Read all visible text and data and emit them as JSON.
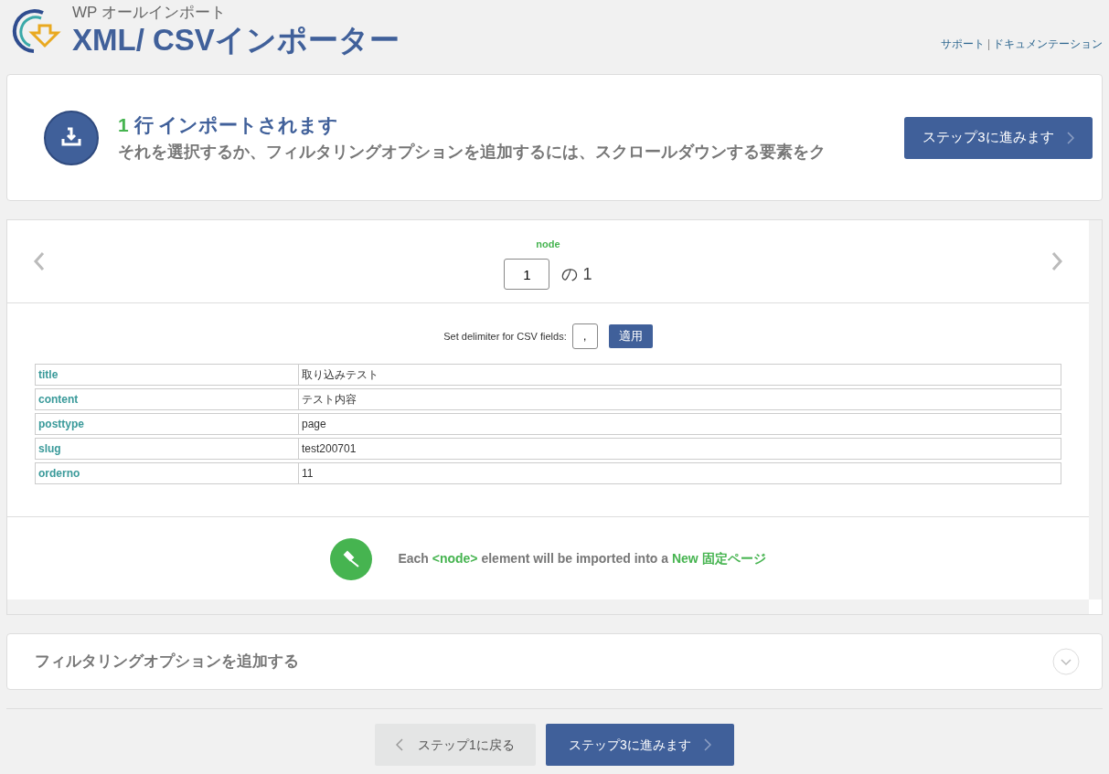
{
  "header": {
    "subtitle": "WP オールインポート",
    "title": "XML/ CSVインポーター",
    "links": [
      "サポート",
      "ドキュメンテーション"
    ],
    "link_separator": "|"
  },
  "summary": {
    "count": "1",
    "headline": "行 インポートされます",
    "description": "それを選択するか、フィルタリングオプションを追加するには、スクロールダウンする要素をク",
    "button": "ステップ3に進みます"
  },
  "preview": {
    "node_label": "node",
    "page_value": "1",
    "page_total": "の 1",
    "delimiter_label": "Set delimiter for CSV fields:",
    "delimiter_value": ",",
    "apply_button": "適用",
    "rows": [
      {
        "field": "title",
        "value": "取り込みテスト"
      },
      {
        "field": "content",
        "value": "テスト内容"
      },
      {
        "field": "posttype",
        "value": "page"
      },
      {
        "field": "slug",
        "value": "test200701"
      },
      {
        "field": "orderno",
        "value": "11"
      }
    ],
    "message": [
      {
        "text": "Each ",
        "highlight": false
      },
      {
        "text": "<node>",
        "highlight": true
      },
      {
        "text": " element will be imported into a ",
        "highlight": false
      },
      {
        "text": "New 固定ページ",
        "highlight": true
      }
    ]
  },
  "filter": {
    "title": "フィルタリングオプションを追加する",
    "expanded": false
  },
  "footer": {
    "back_button": "ステップ1に戻る",
    "next_button": "ステップ3に進みます"
  }
}
